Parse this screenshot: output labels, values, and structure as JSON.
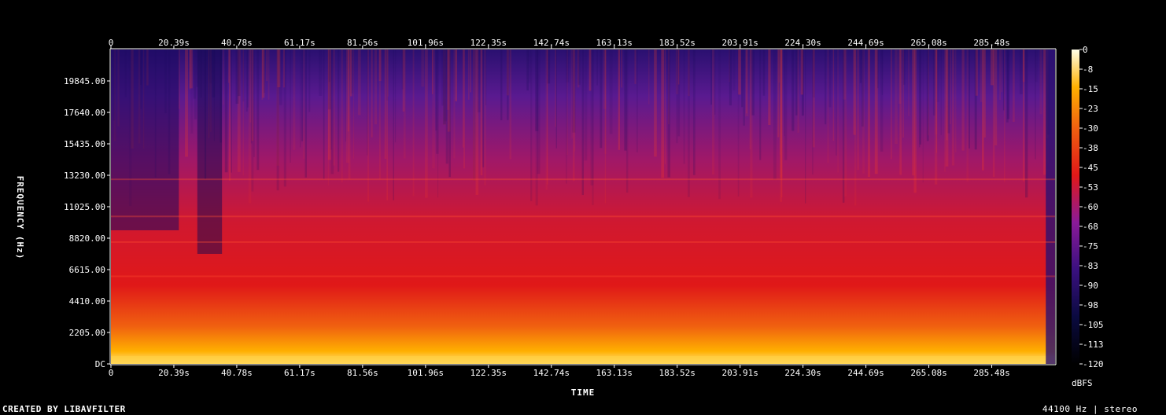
{
  "footer": {
    "created_by": "CREATED BY LIBAVFILTER",
    "sample_info": "44100 Hz | stereo"
  },
  "chart_data": {
    "type": "heatmap",
    "title": "",
    "xlabel": "TIME",
    "ylabel": "FREQUENCY (Hz)",
    "colorbar_label": "dBFS",
    "x_ticks": [
      "0",
      "20.39s",
      "40.78s",
      "61.17s",
      "81.56s",
      "101.96s",
      "122.35s",
      "142.74s",
      "163.13s",
      "183.52s",
      "203.91s",
      "224.30s",
      "244.69s",
      "265.08s",
      "285.48s"
    ],
    "x_tick_values": [
      0,
      20.39,
      40.78,
      61.17,
      81.56,
      101.96,
      122.35,
      142.74,
      163.13,
      183.52,
      203.91,
      224.3,
      244.69,
      265.08,
      285.48
    ],
    "xlim": [
      0,
      306
    ],
    "y_ticks": [
      "DC",
      "2205.00",
      "4410.00",
      "6615.00",
      "8820.00",
      "11025.00",
      "13230.00",
      "15435.00",
      "17640.00",
      "19845.00"
    ],
    "y_tick_values": [
      0,
      2205,
      4410,
      6615,
      8820,
      11025,
      13230,
      15435,
      17640,
      19845
    ],
    "ylim": [
      0,
      22050
    ],
    "colorbar_ticks": [
      "0",
      "-8",
      "-15",
      "-23",
      "-30",
      "-38",
      "-45",
      "-53",
      "-60",
      "-68",
      "-75",
      "-83",
      "-90",
      "-98",
      "-105",
      "-113",
      "-120"
    ],
    "colorbar_range": [
      -120,
      0
    ],
    "colors": {
      "low": "#000000",
      "mid_low": "#1a0a5a",
      "mid": "#7a1aa0",
      "mid_high": "#e01818",
      "high": "#ffb000",
      "peak": "#ffffe0"
    }
  }
}
